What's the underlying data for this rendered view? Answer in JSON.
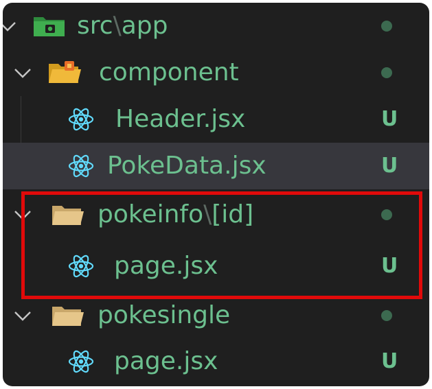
{
  "explorer": {
    "rows": [
      {
        "name_start": "src",
        "separator": "\\",
        "name_end": "app",
        "status": "dot",
        "icon": "folder-src-open-icon"
      },
      {
        "name": "component",
        "status": "dot",
        "icon": "folder-component-open-icon"
      },
      {
        "name": "Header.jsx",
        "status": "U",
        "icon": "react-icon"
      },
      {
        "name": "PokeData.jsx",
        "status": "U",
        "icon": "react-icon",
        "selected": true
      },
      {
        "name_start": "pokeinfo",
        "separator": "\\",
        "name_end": "[id]",
        "status": "dot",
        "icon": "folder-open-icon"
      },
      {
        "name": "page.jsx",
        "status": "U",
        "icon": "react-icon"
      },
      {
        "name": "pokesingle",
        "status": "dot",
        "icon": "folder-open-icon"
      },
      {
        "name": "page.jsx",
        "status": "U",
        "icon": "react-icon"
      }
    ]
  },
  "colors": {
    "background": "#1f1f1f",
    "selected_row": "#37373d",
    "untracked_text": "#6cc08f",
    "status_dot": "#3c6a50",
    "highlight_border": "#e10a0a",
    "react_icon": "#61dafb"
  }
}
